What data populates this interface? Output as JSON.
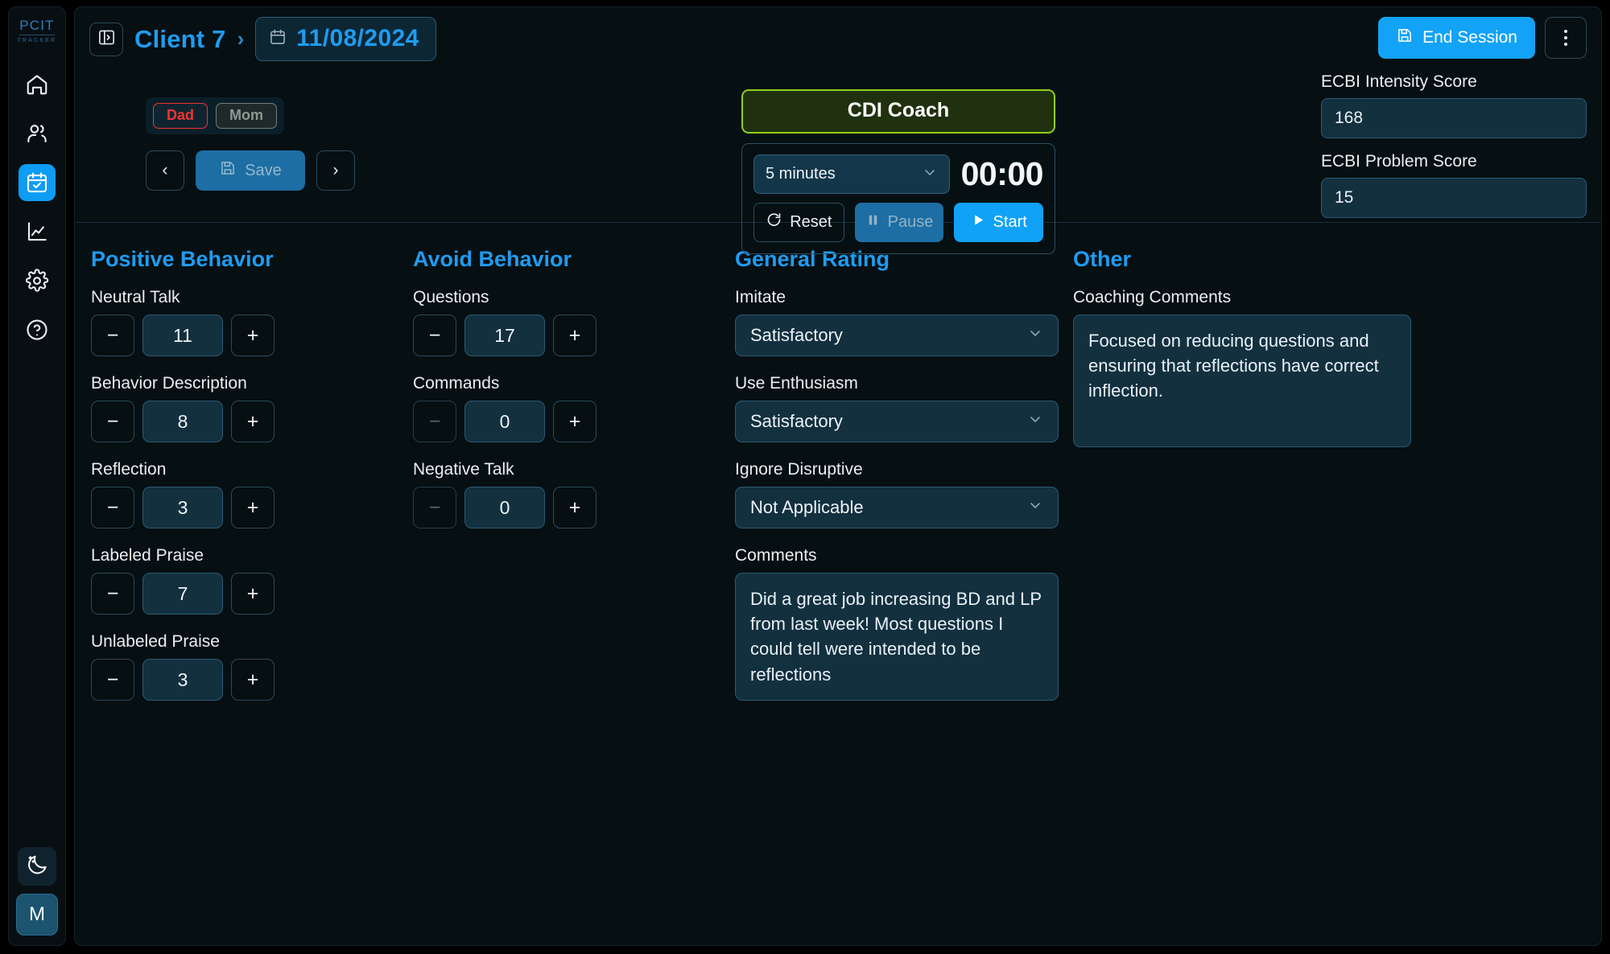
{
  "sidebar": {
    "logo": {
      "main": "PCIT",
      "sub": "TRACKER"
    },
    "items": [
      {
        "name": "home",
        "icon": "home-icon",
        "active": false
      },
      {
        "name": "clients",
        "icon": "users-icon",
        "active": false
      },
      {
        "name": "sessions",
        "icon": "calendar-check-icon",
        "active": true
      },
      {
        "name": "progress",
        "icon": "chart-line-icon",
        "active": false
      },
      {
        "name": "settings",
        "icon": "gear-icon",
        "active": false
      },
      {
        "name": "help",
        "icon": "help-circle-icon",
        "active": false
      }
    ],
    "theme_toggle_icon": "moon-stars-icon",
    "avatar_initial": "M"
  },
  "header": {
    "panel_toggle_icon": "sidebar-toggle-icon",
    "client_title": "Client 7",
    "separator": "›",
    "date_icon": "calendar-icon",
    "date": "11/08/2024",
    "end_session_label": "End Session",
    "end_session_icon": "save-icon",
    "kebab_icon": "more-vertical-icon",
    "ecbi_intensity_label": "ECBI Intensity Score",
    "ecbi_intensity_value": "168",
    "ecbi_problem_label": "ECBI Problem Score",
    "ecbi_problem_value": "15"
  },
  "parent_toggle": {
    "options": [
      {
        "label": "Dad",
        "selected": true,
        "color": "#ee3535"
      },
      {
        "label": "Mom",
        "selected": false,
        "color": "#8b9a92"
      }
    ]
  },
  "session_nav": {
    "prev_label": "‹",
    "next_label": "›",
    "save_label": "Save",
    "save_icon": "save-icon"
  },
  "coach": {
    "banner_label": "CDI Coach",
    "banner_accent": "#8fd11a"
  },
  "timer": {
    "duration_value": "5 minutes",
    "chevron_icon": "chevron-down-icon",
    "display": "00:00",
    "reset_label": "Reset",
    "reset_icon": "refresh-icon",
    "pause_label": "Pause",
    "pause_icon": "pause-icon",
    "start_label": "Start",
    "start_icon": "play-icon"
  },
  "columns": {
    "positive": {
      "title": "Positive Behavior",
      "fields": [
        {
          "label": "Neutral Talk",
          "value": "11",
          "minus": "−",
          "plus": "+",
          "minus_disabled": false
        },
        {
          "label": "Behavior Description",
          "value": "8",
          "minus": "−",
          "plus": "+",
          "minus_disabled": false
        },
        {
          "label": "Reflection",
          "value": "3",
          "minus": "−",
          "plus": "+",
          "minus_disabled": false
        },
        {
          "label": "Labeled Praise",
          "value": "7",
          "minus": "−",
          "plus": "+",
          "minus_disabled": false
        },
        {
          "label": "Unlabeled Praise",
          "value": "3",
          "minus": "−",
          "plus": "+",
          "minus_disabled": false
        }
      ]
    },
    "avoid": {
      "title": "Avoid Behavior",
      "fields": [
        {
          "label": "Questions",
          "value": "17",
          "minus": "−",
          "plus": "+",
          "minus_disabled": false
        },
        {
          "label": "Commands",
          "value": "0",
          "minus": "−",
          "plus": "+",
          "minus_disabled": true
        },
        {
          "label": "Negative Talk",
          "value": "0",
          "minus": "−",
          "plus": "+",
          "minus_disabled": true
        }
      ]
    },
    "general": {
      "title": "General Rating",
      "selects": [
        {
          "label": "Imitate",
          "value": "Satisfactory"
        },
        {
          "label": "Use Enthusiasm",
          "value": "Satisfactory"
        },
        {
          "label": "Ignore Disruptive",
          "value": "Not Applicable"
        }
      ],
      "comments_label": "Comments",
      "comments_value": "Did a great job increasing BD and LP from last week! Most questions I could tell were intended to be reflections"
    },
    "other": {
      "title": "Other",
      "coaching_label": "Coaching Comments",
      "coaching_value": "Focused on reducing questions and ensuring that reflections have correct inflection."
    }
  }
}
